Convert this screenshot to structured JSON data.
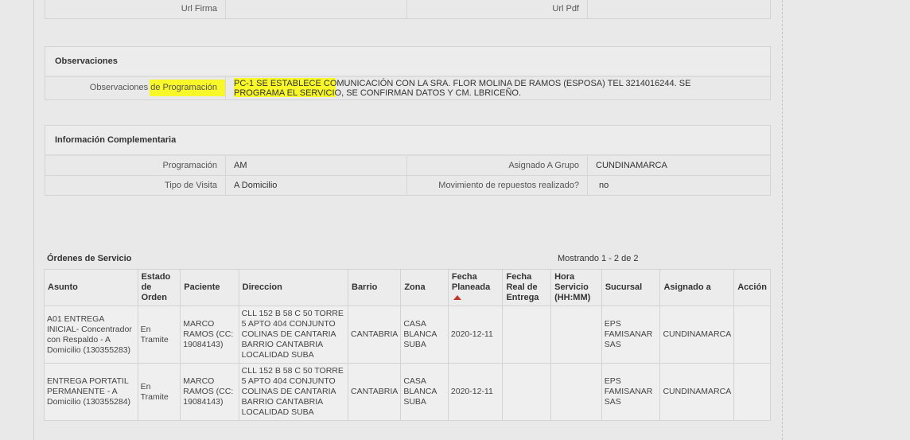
{
  "top_row": {
    "url_firma_label": "Url Firma",
    "url_pdf_label": "Url Pdf"
  },
  "observaciones": {
    "title": "Observaciones",
    "label": "Observaciones de Programación",
    "value": "PC-1 SE ESTABLECE COMUNICACIÓN CON LA SRA. FLOR MOLINA DE RAMOS (ESPOSA) TEL 3214016244. SE PROGRAMA EL SERVICIO, SE CONFIRMAN DATOS Y CM. LBRICEÑO."
  },
  "info": {
    "title": "Información Complementaria",
    "programacion_label": "Programación",
    "programacion_value": "AM",
    "grupo_label": "Asignado A Grupo",
    "grupo_value": "CUNDINAMARCA",
    "tipo_label": "Tipo de Visita",
    "tipo_value": "A Domicilio",
    "repuestos_label": "Movimiento de repuestos realizado?",
    "repuestos_value": "no"
  },
  "orders": {
    "title": "Órdenes de Servicio",
    "showing": "Mostrando 1 - 2 de 2",
    "headers": [
      "Asunto",
      "Estado de Orden",
      "Paciente",
      "Direccion",
      "Barrio",
      "Zona",
      "Fecha Planeada",
      "Fecha Real de Entrega",
      "Hora Servicio (HH:MM)",
      "Sucursal",
      "Asignado a",
      "Acción"
    ],
    "rows": [
      {
        "asunto": "A01 ENTREGA INICIAL- Concentrador con Respaldo - A Domicilio (130355283)",
        "estado": "En Tramite",
        "paciente": "MARCO RAMOS (CC: 19084143)",
        "direccion": "CLL 152 B 58 C 50 TORRE 5 APTO 404 CONJUNTO COLINAS DE CANTARIA BARRIO CANTABRIA LOCALIDAD SUBA",
        "barrio": "CANTABRIA",
        "zona": "CASA BLANCA SUBA",
        "fecha_planeada": "2020-12-11",
        "fecha_real": "",
        "hora": "",
        "sucursal": "EPS FAMISANAR SAS",
        "asignado": "CUNDINAMARCA",
        "accion": ""
      },
      {
        "asunto": "ENTREGA PORTATIL PERMANENTE - A Domicilio (130355284)",
        "estado": "En Tramite",
        "paciente": "MARCO RAMOS (CC: 19084143)",
        "direccion": "CLL 152 B 58 C 50 TORRE 5 APTO 404 CONJUNTO COLINAS DE CANTARIA BARRIO CANTABRIA LOCALIDAD SUBA",
        "barrio": "CANTABRIA",
        "zona": "CASA BLANCA SUBA",
        "fecha_planeada": "2020-12-11",
        "fecha_real": "",
        "hora": "",
        "sucursal": "EPS FAMISANAR SAS",
        "asignado": "CUNDINAMARCA",
        "accion": ""
      }
    ]
  }
}
